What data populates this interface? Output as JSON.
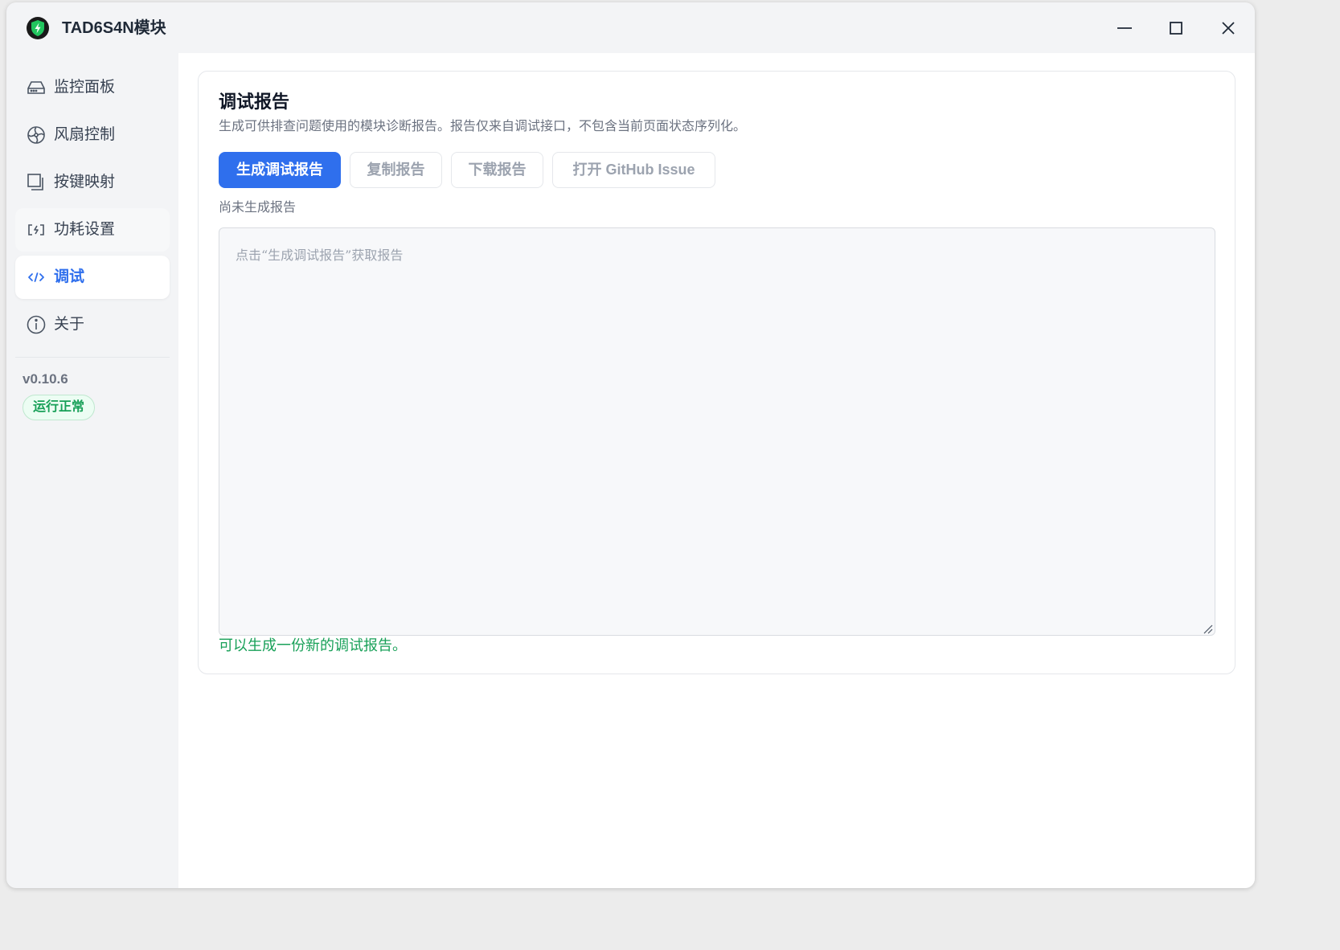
{
  "app": {
    "title": "TAD6S4N模块",
    "logo_icon": "shield-bolt-icon",
    "accent_color": "#2f6fed",
    "success_color": "#18a058"
  },
  "window_controls": [
    "minimize",
    "maximize",
    "close"
  ],
  "sidebar": {
    "items": [
      {
        "label": "监控面板",
        "icon": "drive-icon",
        "active": false
      },
      {
        "label": "风扇控制",
        "icon": "fan-icon",
        "active": false
      },
      {
        "label": "按键映射",
        "icon": "copy-icon",
        "active": false
      },
      {
        "label": "功耗设置",
        "icon": "power-icon",
        "active": false
      },
      {
        "label": "调试",
        "icon": "code-icon",
        "active": true
      },
      {
        "label": "关于",
        "icon": "info-icon",
        "active": false
      }
    ],
    "version": "v0.10.6",
    "status": "运行正常"
  },
  "main": {
    "title": "调试报告",
    "subtitle": "生成可供排查问题使用的模块诊断报告。报告仅来自调试接口，不包含当前页面状态序列化。",
    "buttons": {
      "generate": "生成调试报告",
      "copy": "复制报告",
      "download": "下载报告",
      "github": "打开 GitHub Issue"
    },
    "report_status": "尚未生成报告",
    "report_value": "",
    "report_placeholder": "点击“生成调试报告”获取报告",
    "hint": "可以生成一份新的调试报告。"
  }
}
